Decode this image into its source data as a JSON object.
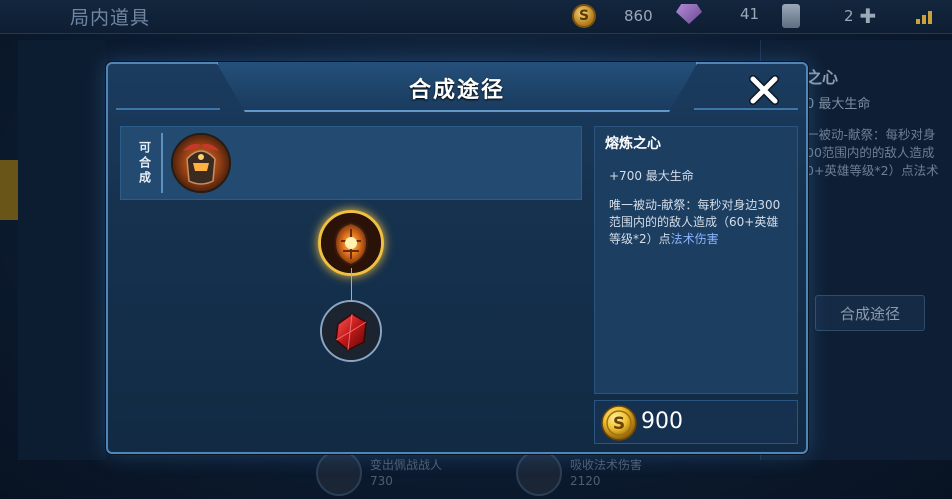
{
  "background": {
    "title": "局内道具",
    "resources": [
      {
        "icon": "gold-coin-icon",
        "value": "860"
      },
      {
        "icon": "gem-icon",
        "value": "41"
      },
      {
        "icon": "card-icon",
        "value": "2"
      }
    ],
    "right_panel": {
      "title": "之心",
      "stat": "0 最大生命",
      "desc": "一被动-献祭：每秒对身\n00范围内的的敌人造成\n0+英雄等级*2）点法术",
      "button": "合成途径"
    },
    "bottom_items": [
      {
        "name": "变出佩战战人",
        "price": "730"
      },
      {
        "name": "吸收法术伤害",
        "price": "2120"
      }
    ]
  },
  "modal": {
    "title": "合成途径",
    "craft_label": "可合成",
    "craft_result_icon": "armor-helmet-icon",
    "tree": {
      "root_icon": "molten-heart-icon",
      "child_icon": "red-crystal-icon"
    },
    "info": {
      "name": "熔炼之心",
      "stat": "+700 最大生命",
      "desc_prefix": "唯一被动-献祭：每秒对身边300范围内的的敌人造成（60+英雄等级*2）点",
      "desc_highlight": "法术伤害"
    },
    "price": "900",
    "colors": {
      "accent": "#4f86b8",
      "highlight": "#8ab4ff",
      "gold": "#e8b830"
    }
  }
}
